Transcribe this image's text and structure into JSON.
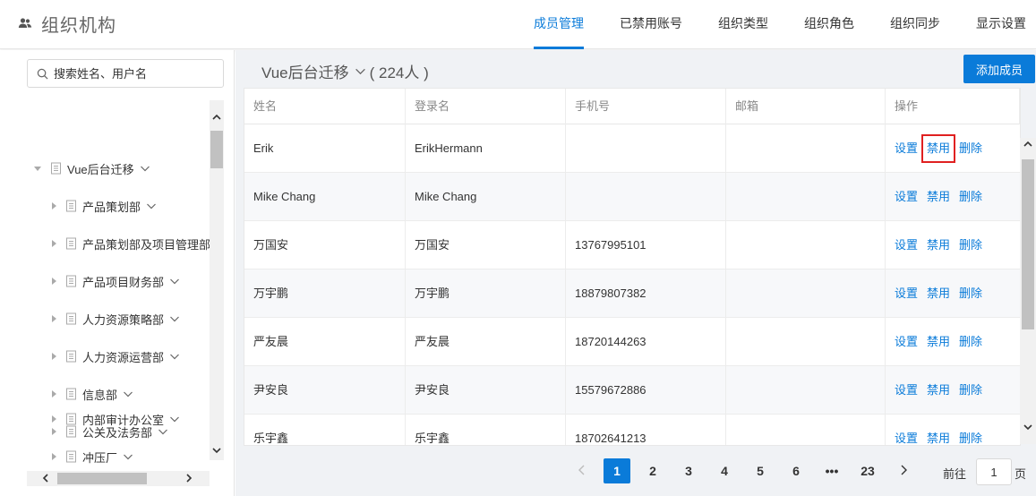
{
  "header": {
    "title": "组织机构",
    "icon": "users-icon",
    "nav": [
      {
        "label": "成员管理",
        "active": true
      },
      {
        "label": "已禁用账号",
        "active": false
      },
      {
        "label": "组织类型",
        "active": false
      },
      {
        "label": "组织角色",
        "active": false
      },
      {
        "label": "组织同步",
        "active": false
      },
      {
        "label": "显示设置",
        "active": false
      }
    ]
  },
  "sidebar": {
    "search_placeholder": "搜索姓名、用户名",
    "tree": [
      {
        "label": "Vue后台迁移",
        "level": 0,
        "expanded": true
      },
      {
        "label": "产品策划部",
        "level": 1
      },
      {
        "label": "产品策划部及项目管理部",
        "level": 1
      },
      {
        "label": "产品项目财务部",
        "level": 1
      },
      {
        "label": "人力资源策略部",
        "level": 1
      },
      {
        "label": "人力资源运营部",
        "level": 1
      },
      {
        "label": "信息部",
        "level": 1
      },
      {
        "label": "公关及法务部",
        "level": 1
      },
      {
        "label": "内部审计办公室",
        "level": 1
      },
      {
        "label": "冲压厂",
        "level": 1
      }
    ]
  },
  "main": {
    "org_name": "Vue后台迁移",
    "member_count": "( 224人 )",
    "add_button": "添加成员",
    "columns": [
      "姓名",
      "登录名",
      "手机号",
      "邮箱",
      "操作"
    ],
    "actions": {
      "settings": "设置",
      "disable": "禁用",
      "delete": "删除"
    },
    "rows": [
      {
        "name": "Erik",
        "login": "ErikHermann",
        "phone": "",
        "email": ""
      },
      {
        "name": "Mike Chang",
        "login": "Mike Chang",
        "phone": "",
        "email": ""
      },
      {
        "name": "万国安",
        "login": "万国安",
        "phone": "13767995101",
        "email": ""
      },
      {
        "name": "万宇鹏",
        "login": "万宇鹏",
        "phone": "18879807382",
        "email": ""
      },
      {
        "name": "严友晨",
        "login": "严友晨",
        "phone": "18720144263",
        "email": ""
      },
      {
        "name": "尹安良",
        "login": "尹安良",
        "phone": "15579672886",
        "email": ""
      },
      {
        "name": "乐宇鑫",
        "login": "乐宇鑫",
        "phone": "18702641213",
        "email": ""
      }
    ]
  },
  "pagination": {
    "pages": [
      "1",
      "2",
      "3",
      "4",
      "5",
      "6",
      "•••",
      "23"
    ],
    "current": "1",
    "goto_label": "前往",
    "goto_value": "1",
    "page_suffix": "页"
  },
  "colors": {
    "accent": "#0a7bd9",
    "highlight": "#e02020"
  }
}
